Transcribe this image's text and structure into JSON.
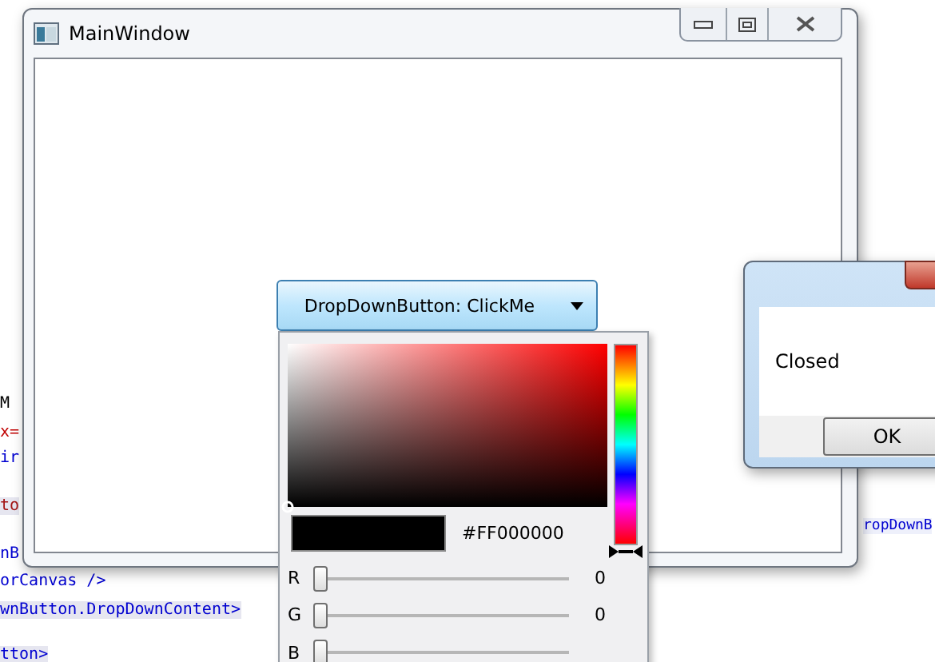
{
  "background_editor": {
    "code_lines": [
      {
        "text": "M",
        "kind": "plain",
        "highlight": false
      },
      {
        "text": "x=",
        "kind": "attribute",
        "highlight": false
      },
      {
        "text": "ir",
        "kind": "keyword",
        "highlight": false
      },
      {
        "text": "to",
        "kind": "tag",
        "highlight": true
      },
      {
        "text": "nB",
        "kind": "keyword",
        "highlight": false
      },
      {
        "text": "orCanvas />",
        "kind": "keyword",
        "highlight": false
      },
      {
        "text": "wnButton.DropDownContent>",
        "kind": "keyword",
        "highlight": true
      },
      {
        "text": "tton>",
        "kind": "keyword",
        "highlight": true
      }
    ],
    "right_fragment": "ropDownB"
  },
  "main_window": {
    "title": "MainWindow",
    "dropdown_button": {
      "label": "DropDownButton: ClickMe",
      "expanded": true
    },
    "color_picker": {
      "hue": {
        "level": 1
      },
      "hex": "#FF000000",
      "channels": [
        {
          "label": "R",
          "level": 0,
          "value": "0"
        },
        {
          "label": "G",
          "level": 0,
          "value": "0"
        },
        {
          "label": "B",
          "level": 0
        }
      ]
    }
  },
  "dialog": {
    "message": "Closed",
    "button": "OK"
  }
}
